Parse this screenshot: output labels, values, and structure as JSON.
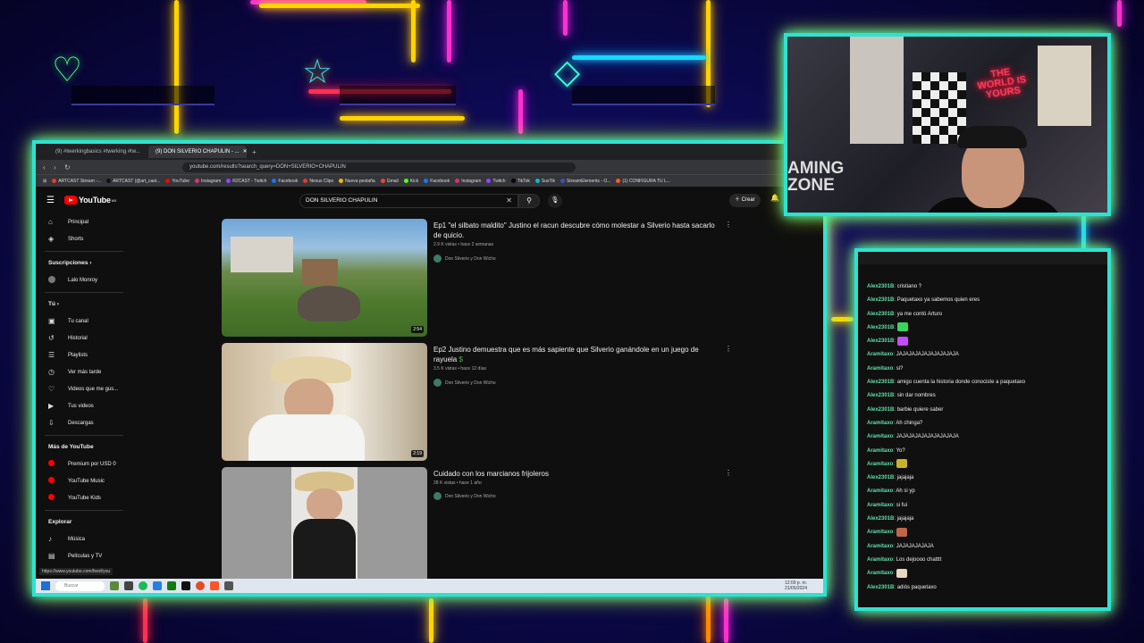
{
  "browser": {
    "tabs": [
      {
        "label": "(9) #twerkingbasics #twerking #tw..."
      },
      {
        "label": "(9) DON SILVERIO CHAPULIN - ..."
      }
    ],
    "new_tab": "+",
    "url": "youtube.com/results?search_query=DON+SILVERIO+CHAPULIN",
    "bookmarks": [
      {
        "label": "ARTCAST Stream -...",
        "color": "#e53935"
      },
      {
        "label": "ARTCAST (@art_cast...",
        "color": "#111111"
      },
      {
        "label": "YouTube",
        "color": "#ff0000"
      },
      {
        "label": "Instagram",
        "color": "#e1306c"
      },
      {
        "label": "R2CAST - Twitch",
        "color": "#9146ff"
      },
      {
        "label": "Facebook",
        "color": "#1877f2"
      },
      {
        "label": "Nexus Clips",
        "color": "#e53935"
      },
      {
        "label": "Nueva pestaña",
        "color": "#f4b400"
      },
      {
        "label": "Gmail",
        "color": "#ea4335"
      },
      {
        "label": "Kick",
        "color": "#53fc18"
      },
      {
        "label": "Facebook",
        "color": "#1877f2"
      },
      {
        "label": "Instagram",
        "color": "#e1306c"
      },
      {
        "label": "Twitch",
        "color": "#9146ff"
      },
      {
        "label": "TikTok",
        "color": "#000000"
      },
      {
        "label": "SusTik",
        "color": "#00bcd4"
      },
      {
        "label": "StreamElements - O...",
        "color": "#3f51b5"
      },
      {
        "label": "(1) CONFIGURA TU L...",
        "color": "#ff5722"
      }
    ],
    "status_url": "https://www.youtube.com/feed/you"
  },
  "youtube": {
    "logo_text": "YouTube",
    "logo_badge": "MX",
    "search_value": "DON SILVERIO CHAPULIN",
    "create_label": "Crear",
    "sidebar": {
      "main": [
        {
          "label": "Principal",
          "icon": "home-icon",
          "glyph": "⌂"
        },
        {
          "label": "Shorts",
          "icon": "shorts-icon",
          "glyph": "◈"
        }
      ],
      "subs_heading": "Suscripciones",
      "subs": [
        {
          "label": "Lalo Monroy"
        }
      ],
      "you_heading": "Tú",
      "you": [
        {
          "label": "Tu canal",
          "icon": "channel-icon",
          "glyph": "▣"
        },
        {
          "label": "Historial",
          "icon": "history-icon",
          "glyph": "↺"
        },
        {
          "label": "Playlists",
          "icon": "playlists-icon",
          "glyph": "☰"
        },
        {
          "label": "Ver más tarde",
          "icon": "watch-later-icon",
          "glyph": "◷"
        },
        {
          "label": "Videos que me gus...",
          "icon": "like-icon",
          "glyph": "♡"
        },
        {
          "label": "Tus videos",
          "icon": "your-videos-icon",
          "glyph": "▶"
        },
        {
          "label": "Descargas",
          "icon": "downloads-icon",
          "glyph": "⇩"
        }
      ],
      "more_heading": "Más de YouTube",
      "more": [
        {
          "label": "Premium por USD 0"
        },
        {
          "label": "YouTube Music"
        },
        {
          "label": "YouTube Kids"
        }
      ],
      "explore_heading": "Explorar",
      "explore": [
        {
          "label": "Música",
          "icon": "music-icon",
          "glyph": "♪"
        },
        {
          "label": "Películas y TV",
          "icon": "movies-icon",
          "glyph": "▤"
        }
      ]
    },
    "results": [
      {
        "title": "Ep1 \"el silbato maldito\" Justino el racun descubre cómo molestar a Silverio hasta sacarlo de quicio.",
        "meta": "2.9 K vistas • hace 2 semanas",
        "channel": "Don Silverio y Don Wicho",
        "duration": "2:54"
      },
      {
        "title": "Ep2 Justino demuestra que es más sapiente que Silverio ganándole en un juego de rayuela",
        "title_suffix": "$",
        "meta": "3.5 K vistas • hace 12 días",
        "channel": "Don Silverio y Don Wicho",
        "duration": "2:19"
      },
      {
        "title": "Cuidado con los marcianos frijoleros",
        "meta": "28 K vistas • hace 1 año",
        "channel": "Don Silverio y Don Wicho",
        "duration": ""
      }
    ]
  },
  "taskbar": {
    "search_placeholder": "Buscar",
    "clock": "12:09 p. m.",
    "date": "21/05/2024"
  },
  "webcam": {
    "neon_sign": "THE WORLD IS YOURS",
    "wall_text": "AMING\nZONE"
  },
  "chat": {
    "messages": [
      {
        "user": "Alex2301B",
        "text": "cristiano ?"
      },
      {
        "user": "Alex2301B",
        "text": "Paquetaxo ya sabemos quien eres"
      },
      {
        "user": "Alex2301B",
        "text": "ya me contó Arturo"
      },
      {
        "user": "Alex2301B",
        "text": "",
        "emote": "#3ad65a"
      },
      {
        "user": "Alex2301B",
        "text": "",
        "emote": "#c64bff"
      },
      {
        "user": "Aramitaxo",
        "text": "JAJAJAJAJAJAJAJAJAJA"
      },
      {
        "user": "Aramitaxo",
        "text": "si?"
      },
      {
        "user": "Alex2301B",
        "text": "amigo cuenta la historia donde conociste a paquetaxo"
      },
      {
        "user": "Alex2301B",
        "text": "sin dar nombres"
      },
      {
        "user": "Alex2301B",
        "text": "barbie quiere saber"
      },
      {
        "user": "Aramitaxo",
        "text": "Ah chinga?"
      },
      {
        "user": "Aramitaxo",
        "text": "JAJAJAJAJAJAJAJAJAJA"
      },
      {
        "user": "Aramitaxo",
        "text": "Yo?"
      },
      {
        "user": "Aramitaxo",
        "text": "",
        "emote": "#c8b42a"
      },
      {
        "user": "Alex2301B",
        "text": "jajajaja"
      },
      {
        "user": "Aramitaxo",
        "text": "Ah si yp"
      },
      {
        "user": "Aramitaxo",
        "text": "si fui"
      },
      {
        "user": "Alex2301B",
        "text": "jajajaja"
      },
      {
        "user": "Aramitaxo",
        "text": "",
        "emote": "#c0664a"
      },
      {
        "user": "Aramitaxo",
        "text": "JAJAJAJAJAJA"
      },
      {
        "user": "Aramitaxo",
        "text": "Los dejoooo chatttt"
      },
      {
        "user": "Aramitaxo",
        "text": "",
        "emote": "#e8d8c0"
      },
      {
        "user": "Alex2301B",
        "text": "adiós paquetaxo"
      }
    ]
  }
}
